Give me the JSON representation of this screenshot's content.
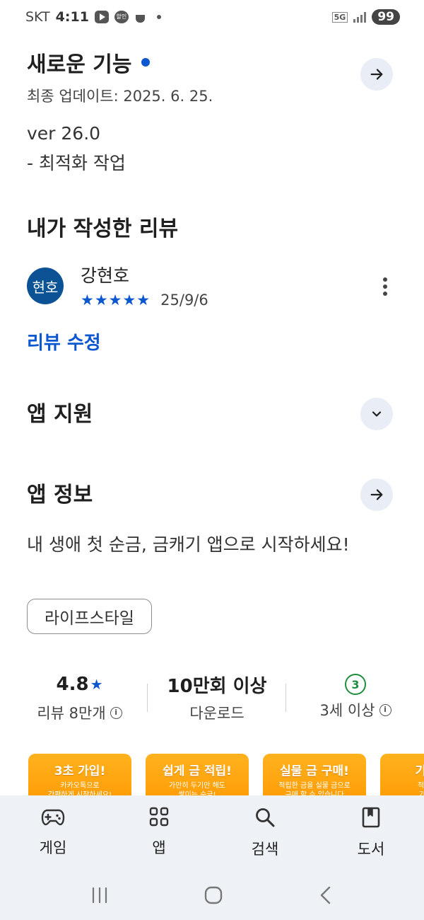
{
  "status_bar": {
    "carrier": "SKT",
    "time": "4:11",
    "network": "5G",
    "battery": "99",
    "sale_badge": "할인"
  },
  "whats_new": {
    "title": "새로운 기능",
    "updated": "최종 업데이트: 2025. 6. 25.",
    "version": "ver 26.0",
    "note": "- 최적화 작업"
  },
  "my_review": {
    "title": "내가 작성한 리뷰",
    "avatar_text": "현호",
    "author": "강현호",
    "rating": 5,
    "stars": "★★★★★",
    "date": "25/9/6",
    "edit_label": "리뷰 수정"
  },
  "app_support": {
    "title": "앱 지원"
  },
  "app_info": {
    "title": "앱 정보",
    "description": "내 생애 첫 순금, 금캐기 앱으로 시작하세요!",
    "category": "라이프스타일"
  },
  "stats": {
    "rating_value": "4.8",
    "rating_star": "★",
    "reviews_label": "리뷰 8만개",
    "downloads_value": "10만회 이상",
    "downloads_label": "다운로드",
    "age_badge": "3",
    "age_label": "3세 이상"
  },
  "screenshots": [
    {
      "title": "3초 가입!",
      "sub1": "카카오톡으로",
      "sub2": "간편하게 시작하세요!"
    },
    {
      "title": "쉽게 금 적립!",
      "sub1": "가만히 두기만 해도",
      "sub2": "쌓이는 순금!"
    },
    {
      "title": "실물 금 구매!",
      "sub1": "적립한 금을 실물 금으로",
      "sub2": "구매 할 수 있습니다"
    },
    {
      "title": "기프티",
      "sub1": "적립한 금",
      "sub2": "기프티콘"
    }
  ],
  "bottom_nav": [
    {
      "label": "게임",
      "icon": "gamepad-icon"
    },
    {
      "label": "앱",
      "icon": "apps-grid-icon"
    },
    {
      "label": "검색",
      "icon": "search-icon"
    },
    {
      "label": "도서",
      "icon": "book-icon"
    }
  ],
  "colors": {
    "accent": "#0b57d0",
    "age_green": "#1e8e3e",
    "nav_bg": "#eef1f6",
    "screenshot_orange": "#ffa000"
  }
}
